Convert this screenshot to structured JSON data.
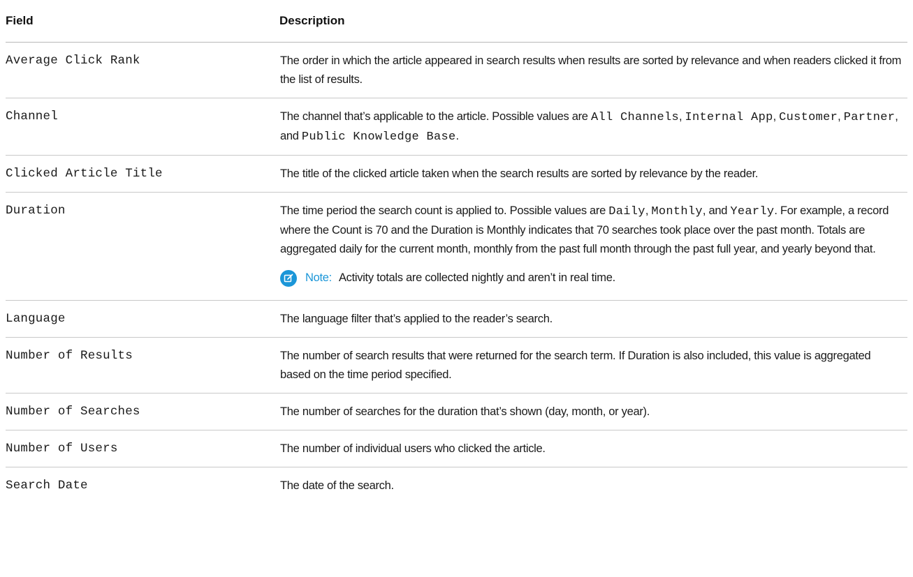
{
  "table": {
    "headers": {
      "field": "Field",
      "description": "Description"
    },
    "rows": {
      "average_click_rank": {
        "field": "Average Click Rank",
        "desc": "The order in which the article appeared in search results when results are sorted by relevance and when readers clicked it from the list of results."
      },
      "channel": {
        "field": "Channel",
        "desc_prefix": "The channel that’s applicable to the article. Possible values are ",
        "v1": "All Channels",
        "sep1": ", ",
        "v2": "Internal App",
        "sep2": ", ",
        "v3": "Customer",
        "sep3": ", ",
        "v4": "Partner",
        "sep4": ", and ",
        "v5": "Public Knowledge Base",
        "end": "."
      },
      "clicked_article_title": {
        "field": "Clicked Article Title",
        "desc": "The title of the clicked article taken when the search results are sorted by relevance by the reader."
      },
      "duration": {
        "field": "Duration",
        "desc_prefix": "The time period the search count is applied to. Possible values are ",
        "v1": "Daily",
        "sep1": ", ",
        "v2": "Monthly",
        "sep2": ", and ",
        "v3": "Yearly",
        "desc_suffix": ". For example, a record where the Count is 70 and the Duration is Monthly indicates that 70 searches took place over the past month. Totals are aggregated daily for the current month, monthly from the past full month through the past full year, and yearly beyond that.",
        "note_label": "Note:",
        "note_text": "Activity totals are collected nightly and aren’t in real time.",
        "note_icon": "edit-note-icon"
      },
      "language": {
        "field": "Language",
        "desc": "The language filter that’s applied to the reader’s search."
      },
      "number_of_results": {
        "field": "Number of Results",
        "desc": "The number of search results that were returned for the search term. If Duration is also included, this value is aggregated based on the time period specified."
      },
      "number_of_searches": {
        "field": "Number of Searches",
        "desc": "The number of searches for the duration that’s shown (day, month, or year)."
      },
      "number_of_users": {
        "field": "Number of Users",
        "desc": "The number of individual users who clicked the article."
      },
      "search_date": {
        "field": "Search Date",
        "desc": "The date of the search."
      }
    }
  },
  "colors": {
    "note_accent": "#1b96d8",
    "divider": "#c8c8c8"
  }
}
